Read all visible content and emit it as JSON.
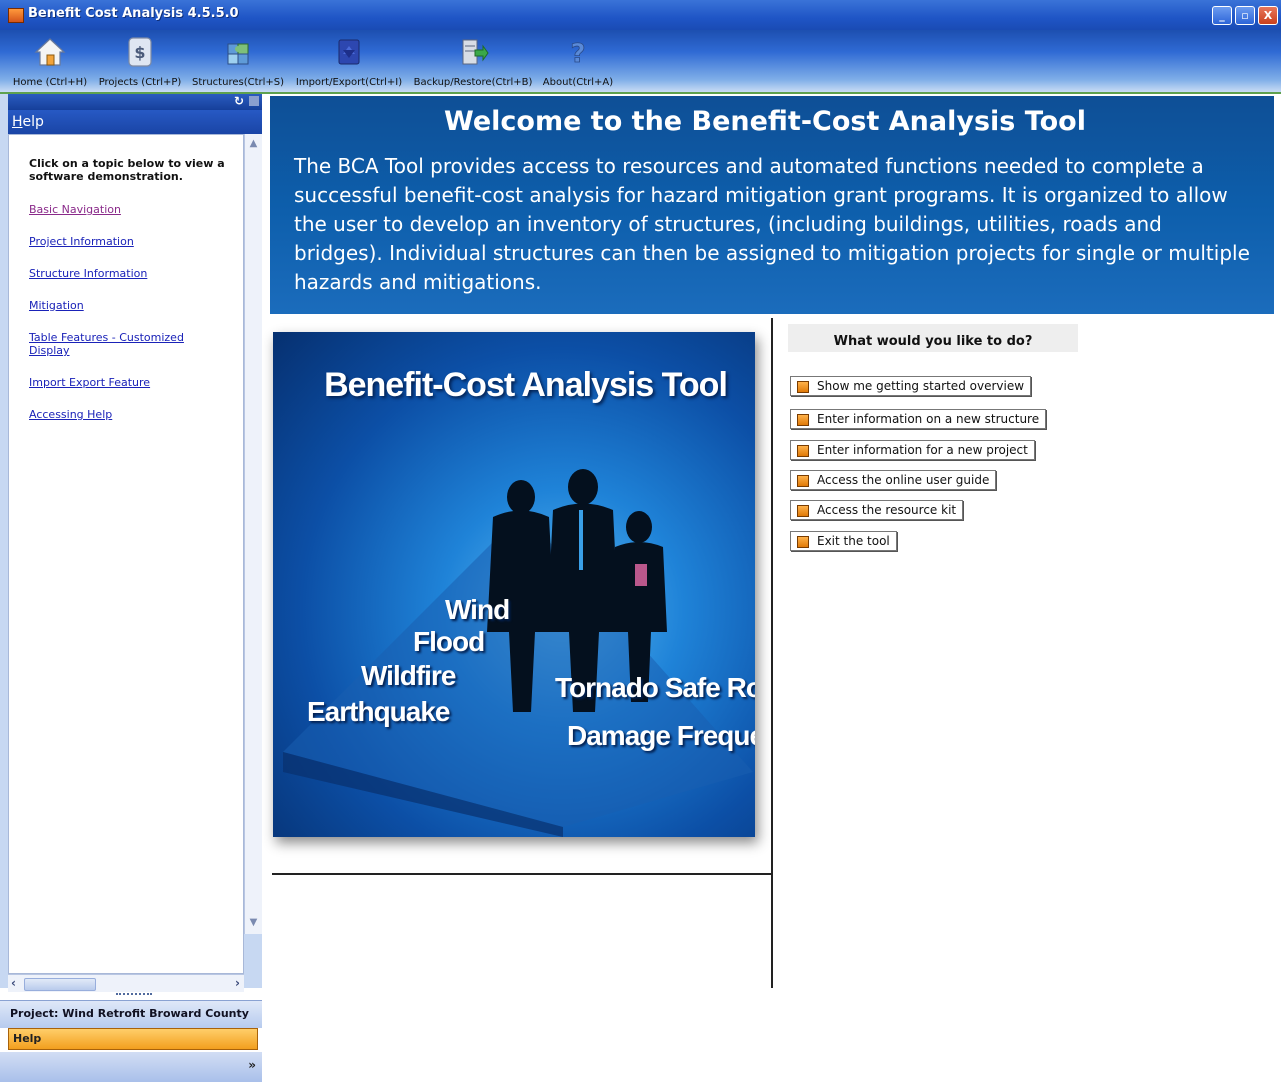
{
  "window": {
    "title": "Benefit Cost Analysis 4.5.5.0",
    "controls": [
      "_",
      "▫",
      "X"
    ]
  },
  "toolbar": {
    "items": [
      {
        "label": "Home (Ctrl+H)",
        "icon": "home-icon"
      },
      {
        "label": "Projects (Ctrl+P)",
        "icon": "dollar-document-icon"
      },
      {
        "label": "Structures(Ctrl+S)",
        "icon": "puzzle-icon"
      },
      {
        "label": "Import/Export(Ctrl+I)",
        "icon": "import-export-icon"
      },
      {
        "label": "Backup/Restore(Ctrl+B)",
        "icon": "server-backup-icon"
      },
      {
        "label": "About(Ctrl+A)",
        "icon": "question-mark-icon"
      }
    ]
  },
  "sidebar": {
    "header_rest": "elp",
    "header_access": "H",
    "intro": "Click on a topic below to view a software demonstration.",
    "links": [
      "Basic Navigation",
      "Project Information",
      "Structure Information",
      "Mitigation",
      "Table Features - Customized Display",
      "Import Export Feature",
      "Accessing Help"
    ],
    "project": "Project: Wind Retrofit Broward County",
    "help_tab": "Help"
  },
  "welcome": {
    "title": "Welcome to the Benefit-Cost Analysis Tool",
    "body": "The BCA Tool provides access to resources and automated functions needed to complete a successful benefit-cost analysis for hazard mitigation grant programs.  It is organized to allow the user to develop an inventory of structures, (including buildings, utilities, roads and bridges). Individual structures can then be assigned to mitigation projects for single or multiple hazards and mitigations."
  },
  "splash": {
    "title": "Benefit-Cost Analysis Tool",
    "hazards": [
      "Wind",
      "Flood",
      "Wildfire",
      "Earthquake"
    ],
    "features": [
      "Tornado Safe Room",
      "Damage Frequency"
    ]
  },
  "actions": {
    "heading": "What would you like to do?",
    "buttons": [
      "Show me getting started overview",
      "Enter information on a new structure",
      "Enter information for a new project",
      "Access the online user guide",
      "Access the resource kit",
      "Exit the tool"
    ]
  }
}
